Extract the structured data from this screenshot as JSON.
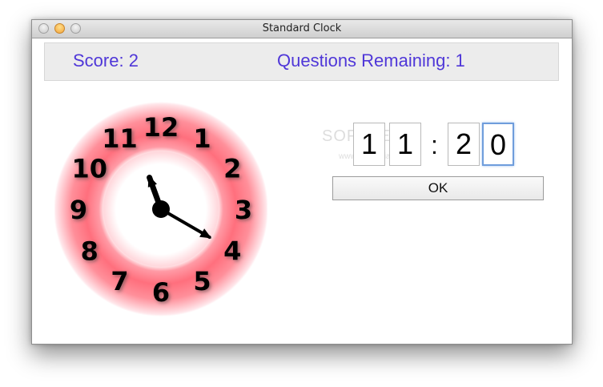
{
  "window": {
    "title": "Standard Clock"
  },
  "status": {
    "score_label": "Score: 2",
    "remaining_label": "Questions Remaining: 1"
  },
  "clock": {
    "numbers": [
      "12",
      "1",
      "2",
      "3",
      "4",
      "5",
      "6",
      "7",
      "8",
      "9",
      "10",
      "11"
    ],
    "hour_hand": 11.0,
    "minute_hand": 20,
    "ring_color": "#ff6f7d",
    "hand_color": "#000000"
  },
  "time_input": {
    "hour_tens": "1",
    "hour_ones": "1",
    "separator": ":",
    "minute_tens": "2",
    "minute_ones": "0"
  },
  "watermark": {
    "text": "SOFTPEDIA",
    "url": "www.softpedia.com"
  },
  "buttons": {
    "ok_label": "OK"
  }
}
